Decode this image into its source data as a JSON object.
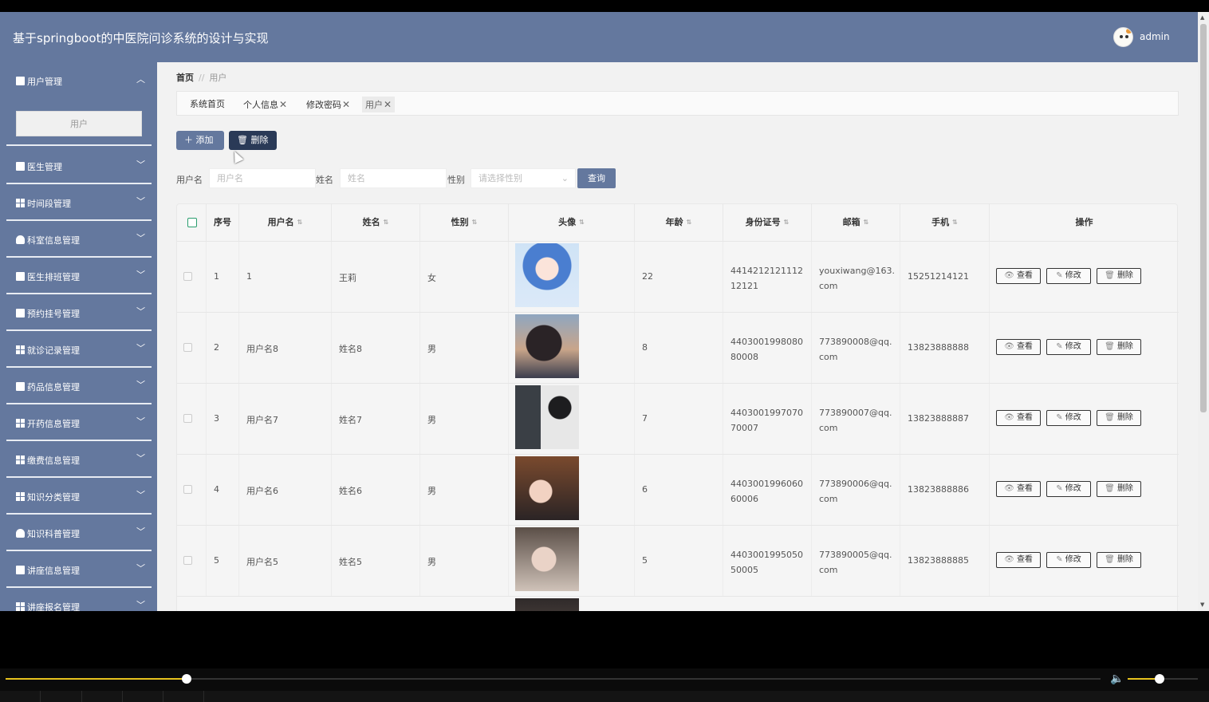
{
  "header": {
    "title": "基于springboot的中医院问诊系统的设计与实现",
    "user": "admin"
  },
  "sidebar": {
    "items": [
      {
        "label": "用户管理",
        "icon": "message-icon",
        "expanded": true
      },
      {
        "label": "医生管理",
        "icon": "send-icon"
      },
      {
        "label": "时间段管理",
        "icon": "grid-icon"
      },
      {
        "label": "科室信息管理",
        "icon": "user-icon"
      },
      {
        "label": "医生排班管理",
        "icon": "checkbox-icon"
      },
      {
        "label": "预约挂号管理",
        "icon": "bar-chart-icon"
      },
      {
        "label": "就诊记录管理",
        "icon": "grid-icon"
      },
      {
        "label": "药品信息管理",
        "icon": "message-icon"
      },
      {
        "label": "开药信息管理",
        "icon": "grid-icon"
      },
      {
        "label": "缴费信息管理",
        "icon": "grid-icon"
      },
      {
        "label": "知识分类管理",
        "icon": "apps-icon"
      },
      {
        "label": "知识科普管理",
        "icon": "user-icon"
      },
      {
        "label": "讲座信息管理",
        "icon": "checkbox-icon"
      },
      {
        "label": "讲座报名管理",
        "icon": "grid-icon"
      }
    ],
    "submenu": "用户"
  },
  "breadcrumb": {
    "home": "首页",
    "sep": "//",
    "current": "用户"
  },
  "tabs": [
    {
      "label": "系统首页",
      "closable": false
    },
    {
      "label": "个人信息",
      "closable": true
    },
    {
      "label": "修改密码",
      "closable": true
    },
    {
      "label": "用户",
      "closable": true
    }
  ],
  "toolbar": {
    "add": "添加",
    "delete": "删除"
  },
  "search": {
    "username_label": "用户名",
    "username_placeholder": "用户名",
    "name_label": "姓名",
    "name_placeholder": "姓名",
    "gender_label": "性别",
    "gender_placeholder": "请选择性别",
    "button": "查询"
  },
  "table": {
    "headers": [
      "序号",
      "用户名",
      "姓名",
      "性别",
      "头像",
      "年龄",
      "身份证号",
      "邮箱",
      "手机",
      "操作"
    ],
    "actions": {
      "view": "查看",
      "edit": "修改",
      "delete": "删除"
    },
    "rows": [
      {
        "no": "1",
        "username": "1",
        "name": "王莉",
        "gender": "女",
        "age": "22",
        "id": "441421212111212121",
        "email": "youxiwang@163.com",
        "phone": "15251214121"
      },
      {
        "no": "2",
        "username": "用户名8",
        "name": "姓名8",
        "gender": "男",
        "age": "8",
        "id": "440300199808080008",
        "email": "773890008@qq.com",
        "phone": "13823888888"
      },
      {
        "no": "3",
        "username": "用户名7",
        "name": "姓名7",
        "gender": "男",
        "age": "7",
        "id": "440300199707070007",
        "email": "773890007@qq.com",
        "phone": "13823888887"
      },
      {
        "no": "4",
        "username": "用户名6",
        "name": "姓名6",
        "gender": "男",
        "age": "6",
        "id": "440300199606060006",
        "email": "773890006@qq.com",
        "phone": "13823888886"
      },
      {
        "no": "5",
        "username": "用户名5",
        "name": "姓名5",
        "gender": "男",
        "age": "5",
        "id": "440300199505050005",
        "email": "773890005@qq.com",
        "phone": "13823888885"
      }
    ]
  },
  "player": {
    "progress": 0.165,
    "volume": 0.45
  },
  "colors": {
    "header": "#64789e",
    "accent": "#e8c31e",
    "dark_button": "#2a3a57"
  }
}
